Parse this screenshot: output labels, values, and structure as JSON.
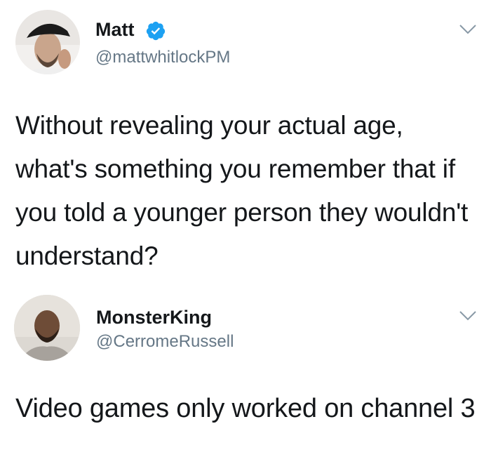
{
  "tweets": [
    {
      "name": "Matt",
      "verified": true,
      "handle": "@mattwhitlockPM",
      "text": "Without revealing your actual age, what's something you remember that if you told a younger person they wouldn't understand?"
    },
    {
      "name": "MonsterKing",
      "verified": false,
      "handle": "@CerromeRussell",
      "text": "Video games only worked on channel 3"
    }
  ],
  "colors": {
    "text": "#14171a",
    "handle": "#657786",
    "verified": "#1da1f2"
  },
  "icons": [
    "avatar",
    "verified-badge-icon",
    "chevron-down-icon"
  ]
}
